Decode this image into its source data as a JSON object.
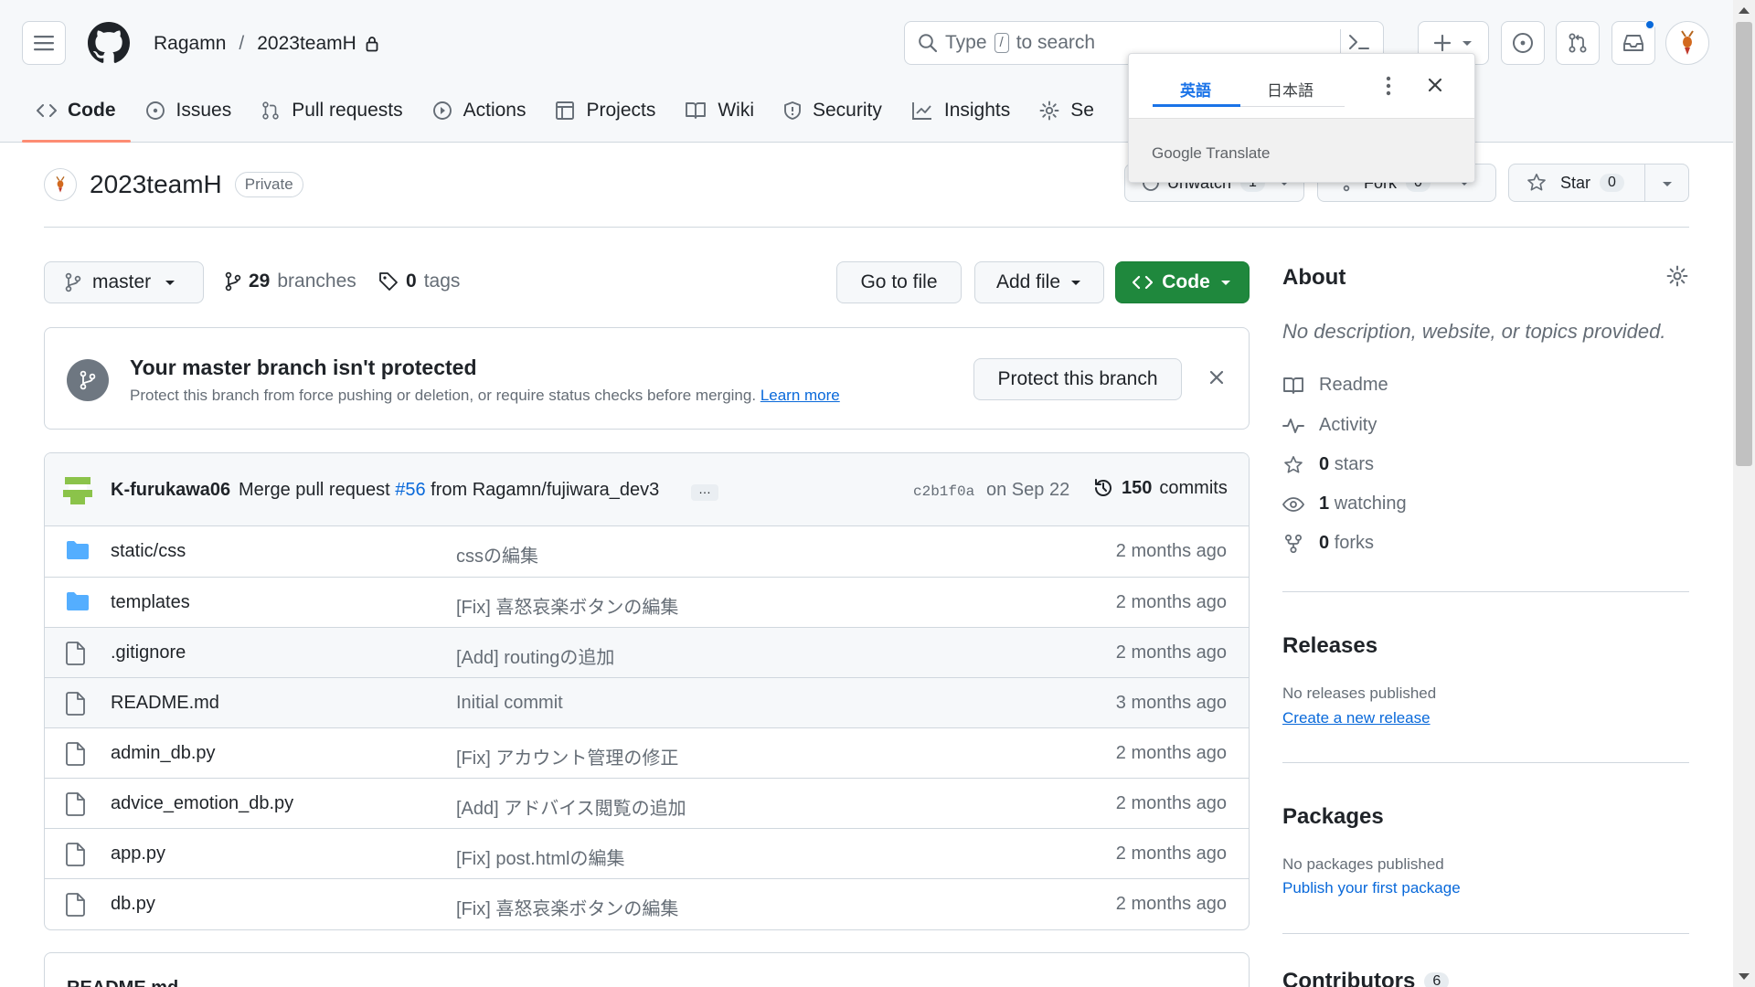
{
  "header": {
    "owner": "Ragamn",
    "separator": "/",
    "repo": "2023teamH",
    "search_placeholder_pre": "Type",
    "search_slash": "/",
    "search_placeholder_post": "to search"
  },
  "tabs": [
    {
      "label": "Code",
      "icon": "code-icon"
    },
    {
      "label": "Issues",
      "icon": "issue-icon"
    },
    {
      "label": "Pull requests",
      "icon": "pull-request-icon"
    },
    {
      "label": "Actions",
      "icon": "play-icon"
    },
    {
      "label": "Projects",
      "icon": "table-icon"
    },
    {
      "label": "Wiki",
      "icon": "book-icon"
    },
    {
      "label": "Security",
      "icon": "shield-icon"
    },
    {
      "label": "Insights",
      "icon": "graph-icon"
    },
    {
      "label": "Se",
      "icon": "gear-icon"
    }
  ],
  "repo_title": {
    "name": "2023teamH",
    "visibility": "Private",
    "unwatch_label": "Unwatch",
    "unwatch_count": "1",
    "fork_label": "Fork",
    "fork_count": "0",
    "star_label": "Star",
    "star_count": "0"
  },
  "toolbar": {
    "branch": "master",
    "branches_count": "29",
    "branches_label": "branches",
    "tags_count": "0",
    "tags_label": "tags",
    "go_to_file": "Go to file",
    "add_file": "Add file",
    "code": "Code"
  },
  "banner": {
    "title": "Your master branch isn't protected",
    "description": "Protect this branch from force pushing or deletion, or require status checks before merging.",
    "learn_more": "Learn more",
    "button": "Protect this branch"
  },
  "commit": {
    "author": "K-furukawa06",
    "message_pre": "Merge pull request",
    "pr": "#56",
    "message_post": "from Ragamn/fujiwara_dev3",
    "ellipsis": "…",
    "sha": "c2b1f0a",
    "date": "on Sep 22",
    "count": "150",
    "count_label": "commits"
  },
  "files": [
    {
      "type": "folder",
      "name": "static/css",
      "message": "cssの編集",
      "date": "2 months ago"
    },
    {
      "type": "folder",
      "name": "templates",
      "message": "[Fix] 喜怒哀楽ボタンの編集",
      "date": "2 months ago"
    },
    {
      "type": "file",
      "name": ".gitignore",
      "message": "[Add] routingの追加",
      "date": "2 months ago"
    },
    {
      "type": "file",
      "name": "README.md",
      "message": "Initial commit",
      "date": "3 months ago"
    },
    {
      "type": "file",
      "name": "admin_db.py",
      "message": "[Fix] アカウント管理の修正",
      "date": "2 months ago"
    },
    {
      "type": "file",
      "name": "advice_emotion_db.py",
      "message": "[Add] アドバイス閲覧の追加",
      "date": "2 months ago"
    },
    {
      "type": "file",
      "name": "app.py",
      "message": "[Fix] post.htmlの編集",
      "date": "2 months ago"
    },
    {
      "type": "file",
      "name": "db.py",
      "message": "[Fix] 喜怒哀楽ボタンの編集",
      "date": "2 months ago"
    }
  ],
  "readme_title": "README.md",
  "about": {
    "title": "About",
    "description": "No description, website, or topics provided.",
    "readme": "Readme",
    "activity": "Activity",
    "stars_count": "0",
    "stars_label": "stars",
    "watching_count": "1",
    "watching_label": "watching",
    "forks_count": "0",
    "forks_label": "forks"
  },
  "releases": {
    "title": "Releases",
    "none": "No releases published",
    "create": "Create a new release"
  },
  "packages": {
    "title": "Packages",
    "none": "No packages published",
    "publish": "Publish your first package"
  },
  "contributors": {
    "title": "Contributors",
    "count": "6"
  },
  "translate": {
    "lang_selected": "英語",
    "lang_other": "日本語",
    "brand_google": "Google",
    "brand_translate": "Translate"
  },
  "colors": {
    "accent_green": "#1f883d",
    "link_blue": "#0969da",
    "tab_underline": "#fd8c73",
    "translate_blue": "#1a73e8"
  }
}
